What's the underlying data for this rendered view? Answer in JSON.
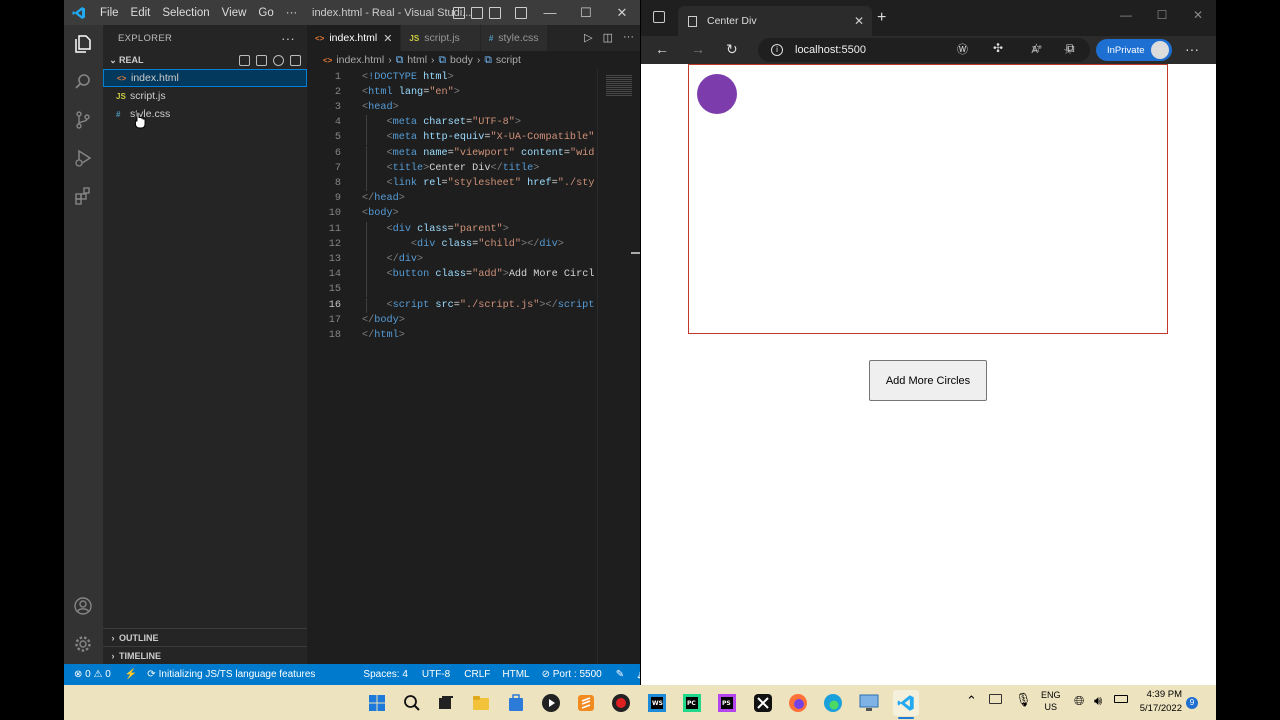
{
  "vscode": {
    "menu": [
      "File",
      "Edit",
      "Selection",
      "View",
      "Go",
      "···"
    ],
    "window_title": "index.html - Real - Visual Studi...",
    "explorer_title": "EXPLORER",
    "folder_name": "REAL",
    "files": [
      {
        "icon": "<>",
        "name": "index.html"
      },
      {
        "icon": "JS",
        "name": "script.js"
      },
      {
        "icon": "#",
        "name": "style.css"
      }
    ],
    "outline_label": "OUTLINE",
    "timeline_label": "TIMELINE",
    "tabs": [
      {
        "icon": "<>",
        "label": "index.html"
      },
      {
        "icon": "JS",
        "label": "script.js"
      },
      {
        "icon": "#",
        "label": "style.css"
      }
    ],
    "breadcrumbs": [
      "index.html",
      "html",
      "body",
      "script"
    ],
    "line_numbers": [
      "1",
      "2",
      "3",
      "4",
      "5",
      "6",
      "7",
      "8",
      "9",
      "10",
      "11",
      "12",
      "13",
      "14",
      "15",
      "16",
      "17",
      "18"
    ],
    "code_lines": [
      "<!DOCTYPE html>",
      "<html lang=\"en\">",
      "<head>",
      "    <meta charset=\"UTF-8\">",
      "    <meta http-equiv=\"X-UA-Compatible\"",
      "    <meta name=\"viewport\" content=\"wid",
      "    <title>Center Div</title>",
      "    <link rel=\"stylesheet\" href=\"./sty",
      "</head>",
      "<body>",
      "    <div class=\"parent\">",
      "        <div class=\"child\"></div>",
      "    </div>",
      "    <button class=\"add\">Add More Circl",
      "",
      "    <script src=\"./script.js\"></script",
      "</body>",
      "</html>"
    ],
    "status": {
      "errors": "⊗ 0 ⚠ 0",
      "message": "Initializing JS/TS language features",
      "spaces": "Spaces: 4",
      "encoding": "UTF-8",
      "eol": "CRLF",
      "language": "HTML",
      "port": "⊘ Port : 5500"
    }
  },
  "browser": {
    "tab_title": "Center Div",
    "address": "localhost:5500",
    "inprivate_label": "InPrivate",
    "button_label": "Add More Circles"
  },
  "taskbar": {
    "lang_top": "ENG",
    "lang_bottom": "US",
    "time": "4:39 PM",
    "date": "5/17/2022",
    "notifications": "9"
  },
  "colors": {
    "vscode_status": "#007acc",
    "circle": "#7d3cab",
    "parent_border": "#c0392b",
    "inprivate": "#1d6fd1"
  }
}
